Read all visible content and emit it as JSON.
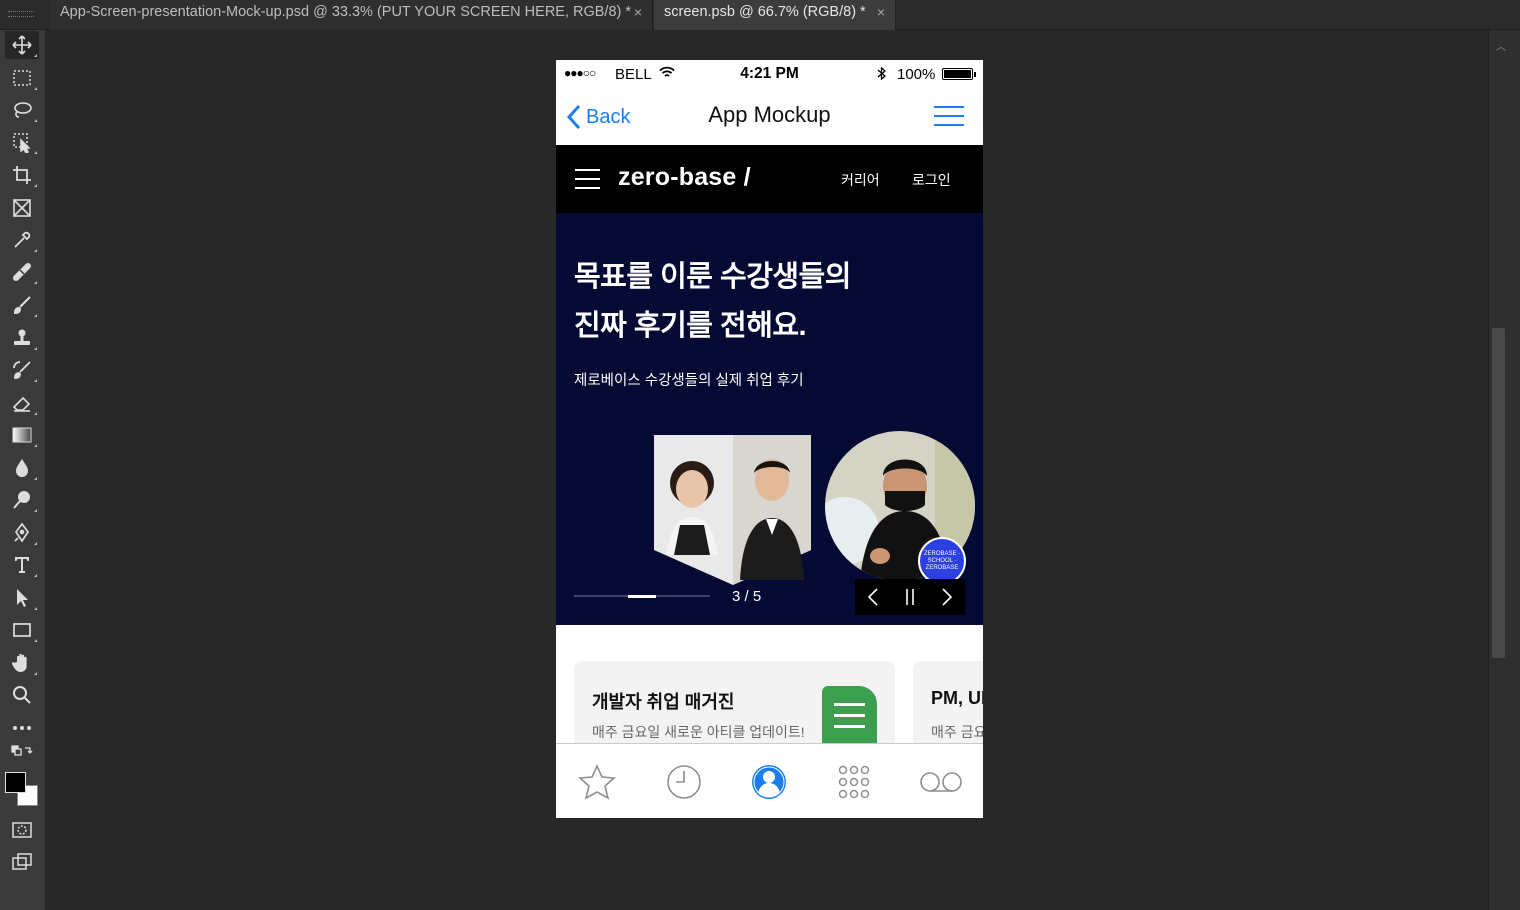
{
  "app": {
    "tabs": [
      {
        "label": "App-Screen-presentation-Mock-up.psd @ 33.3% (PUT YOUR SCREEN HERE, RGB/8) *",
        "close": "×"
      },
      {
        "label": "screen.psb @ 66.7% (RGB/8) *",
        "close": "×"
      }
    ],
    "tools": [
      "move-tool-icon",
      "marquee-tool-icon",
      "lasso-tool-icon",
      "object-select-tool-icon",
      "crop-tool-icon",
      "frame-tool-icon",
      "eyedropper-tool-icon",
      "healing-brush-tool-icon",
      "brush-tool-icon",
      "clone-stamp-tool-icon",
      "history-brush-tool-icon",
      "eraser-tool-icon",
      "gradient-tool-icon",
      "blur-tool-icon",
      "dodge-tool-icon",
      "pen-tool-icon",
      "type-tool-icon",
      "path-select-tool-icon",
      "rectangle-tool-icon",
      "hand-tool-icon",
      "zoom-tool-icon",
      "more-tools-icon"
    ],
    "colors": {
      "foreground": "#000000",
      "background": "#ffffff"
    }
  },
  "phone": {
    "status": {
      "signal": "●●●○○",
      "carrier": "BELL",
      "time": "4:21 PM",
      "battery": "100%"
    },
    "nav": {
      "back": "Back",
      "title": "App Mockup"
    },
    "site": {
      "logo": "zero-base /",
      "nav_links": [
        "커리어",
        "로그인"
      ],
      "hero": {
        "headline_1": "목표를 이룬 수강생들의",
        "headline_2": "진짜 후기를 전해요.",
        "subtitle": "제로베이스 수강생들의 실제 취업 후기",
        "counter": "3 / 5",
        "progress": 0.6,
        "badge": "ZEROBASE · SCHOOL · ZEROBASE"
      },
      "cards": [
        {
          "title": "개발자 취업 매거진",
          "subtitle": "매주 금요일 새로운 아티클 업데이트!"
        },
        {
          "title": "PM, UI",
          "subtitle": "매주 금요"
        }
      ]
    },
    "tabbar": [
      "star-icon",
      "clock-icon",
      "contact-icon",
      "keypad-icon",
      "voicemail-icon"
    ],
    "accent": "#1a7ef0"
  }
}
